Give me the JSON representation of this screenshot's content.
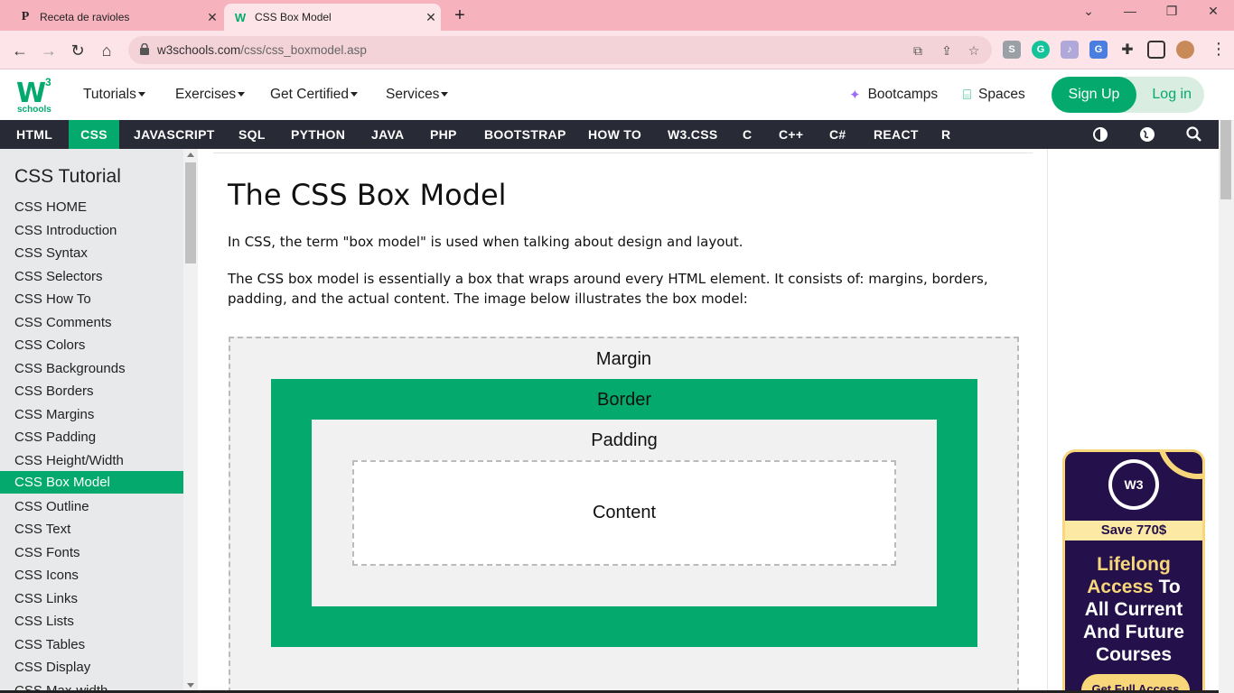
{
  "browser": {
    "tabs": [
      {
        "title": "Receta de ravioles",
        "favicon": "P"
      },
      {
        "title": "CSS Box Model",
        "favicon": "W"
      }
    ],
    "url_host": "w3schools.com",
    "url_path": "/css/css_boxmodel.asp"
  },
  "nav": {
    "menus": [
      "Tutorials",
      "Exercises",
      "Get Certified",
      "Services"
    ],
    "bootcamps": "Bootcamps",
    "spaces": "Spaces",
    "signup": "Sign Up",
    "login": "Log in",
    "logo_w": "W",
    "logo_3": "3",
    "logo_schools": "schools"
  },
  "langbar": [
    "HTML",
    "CSS",
    "JAVASCRIPT",
    "SQL",
    "PYTHON",
    "JAVA",
    "PHP",
    "BOOTSTRAP",
    "HOW TO",
    "W3.CSS",
    "C",
    "C++",
    "C#",
    "REACT",
    "R"
  ],
  "sidebar": {
    "title": "CSS Tutorial",
    "items": [
      "CSS HOME",
      "CSS Introduction",
      "CSS Syntax",
      "CSS Selectors",
      "CSS How To",
      "CSS Comments",
      "CSS Colors",
      "CSS Backgrounds",
      "CSS Borders",
      "CSS Margins",
      "CSS Padding",
      "CSS Height/Width",
      "CSS Box Model",
      "CSS Outline",
      "CSS Text",
      "CSS Fonts",
      "CSS Icons",
      "CSS Links",
      "CSS Lists",
      "CSS Tables",
      "CSS Display",
      "CSS Max-width"
    ],
    "active_index": 12
  },
  "main": {
    "title": "The CSS Box Model",
    "para1": "In CSS, the term \"box model\" is used when talking about design and layout.",
    "para2": "The CSS box model is essentially a box that wraps around every HTML element. It consists of: margins, borders, padding, and the actual content. The image below illustrates the box model:",
    "box": {
      "margin": "Margin",
      "border": "Border",
      "padding": "Padding",
      "content": "Content"
    }
  },
  "ad": {
    "badge": "W3",
    "save": "Save 770$",
    "line1a": "Lifelong",
    "line1b": "Access",
    "line1c": "To",
    "line2": "All Current",
    "line3": "And Future",
    "line4": "Courses",
    "cta": "Get Full Access"
  },
  "colors": {
    "accent": "#04aa6d",
    "tabbar": "#f6b3be",
    "langbar": "#282a35",
    "sidebar": "#e7e9eb"
  }
}
